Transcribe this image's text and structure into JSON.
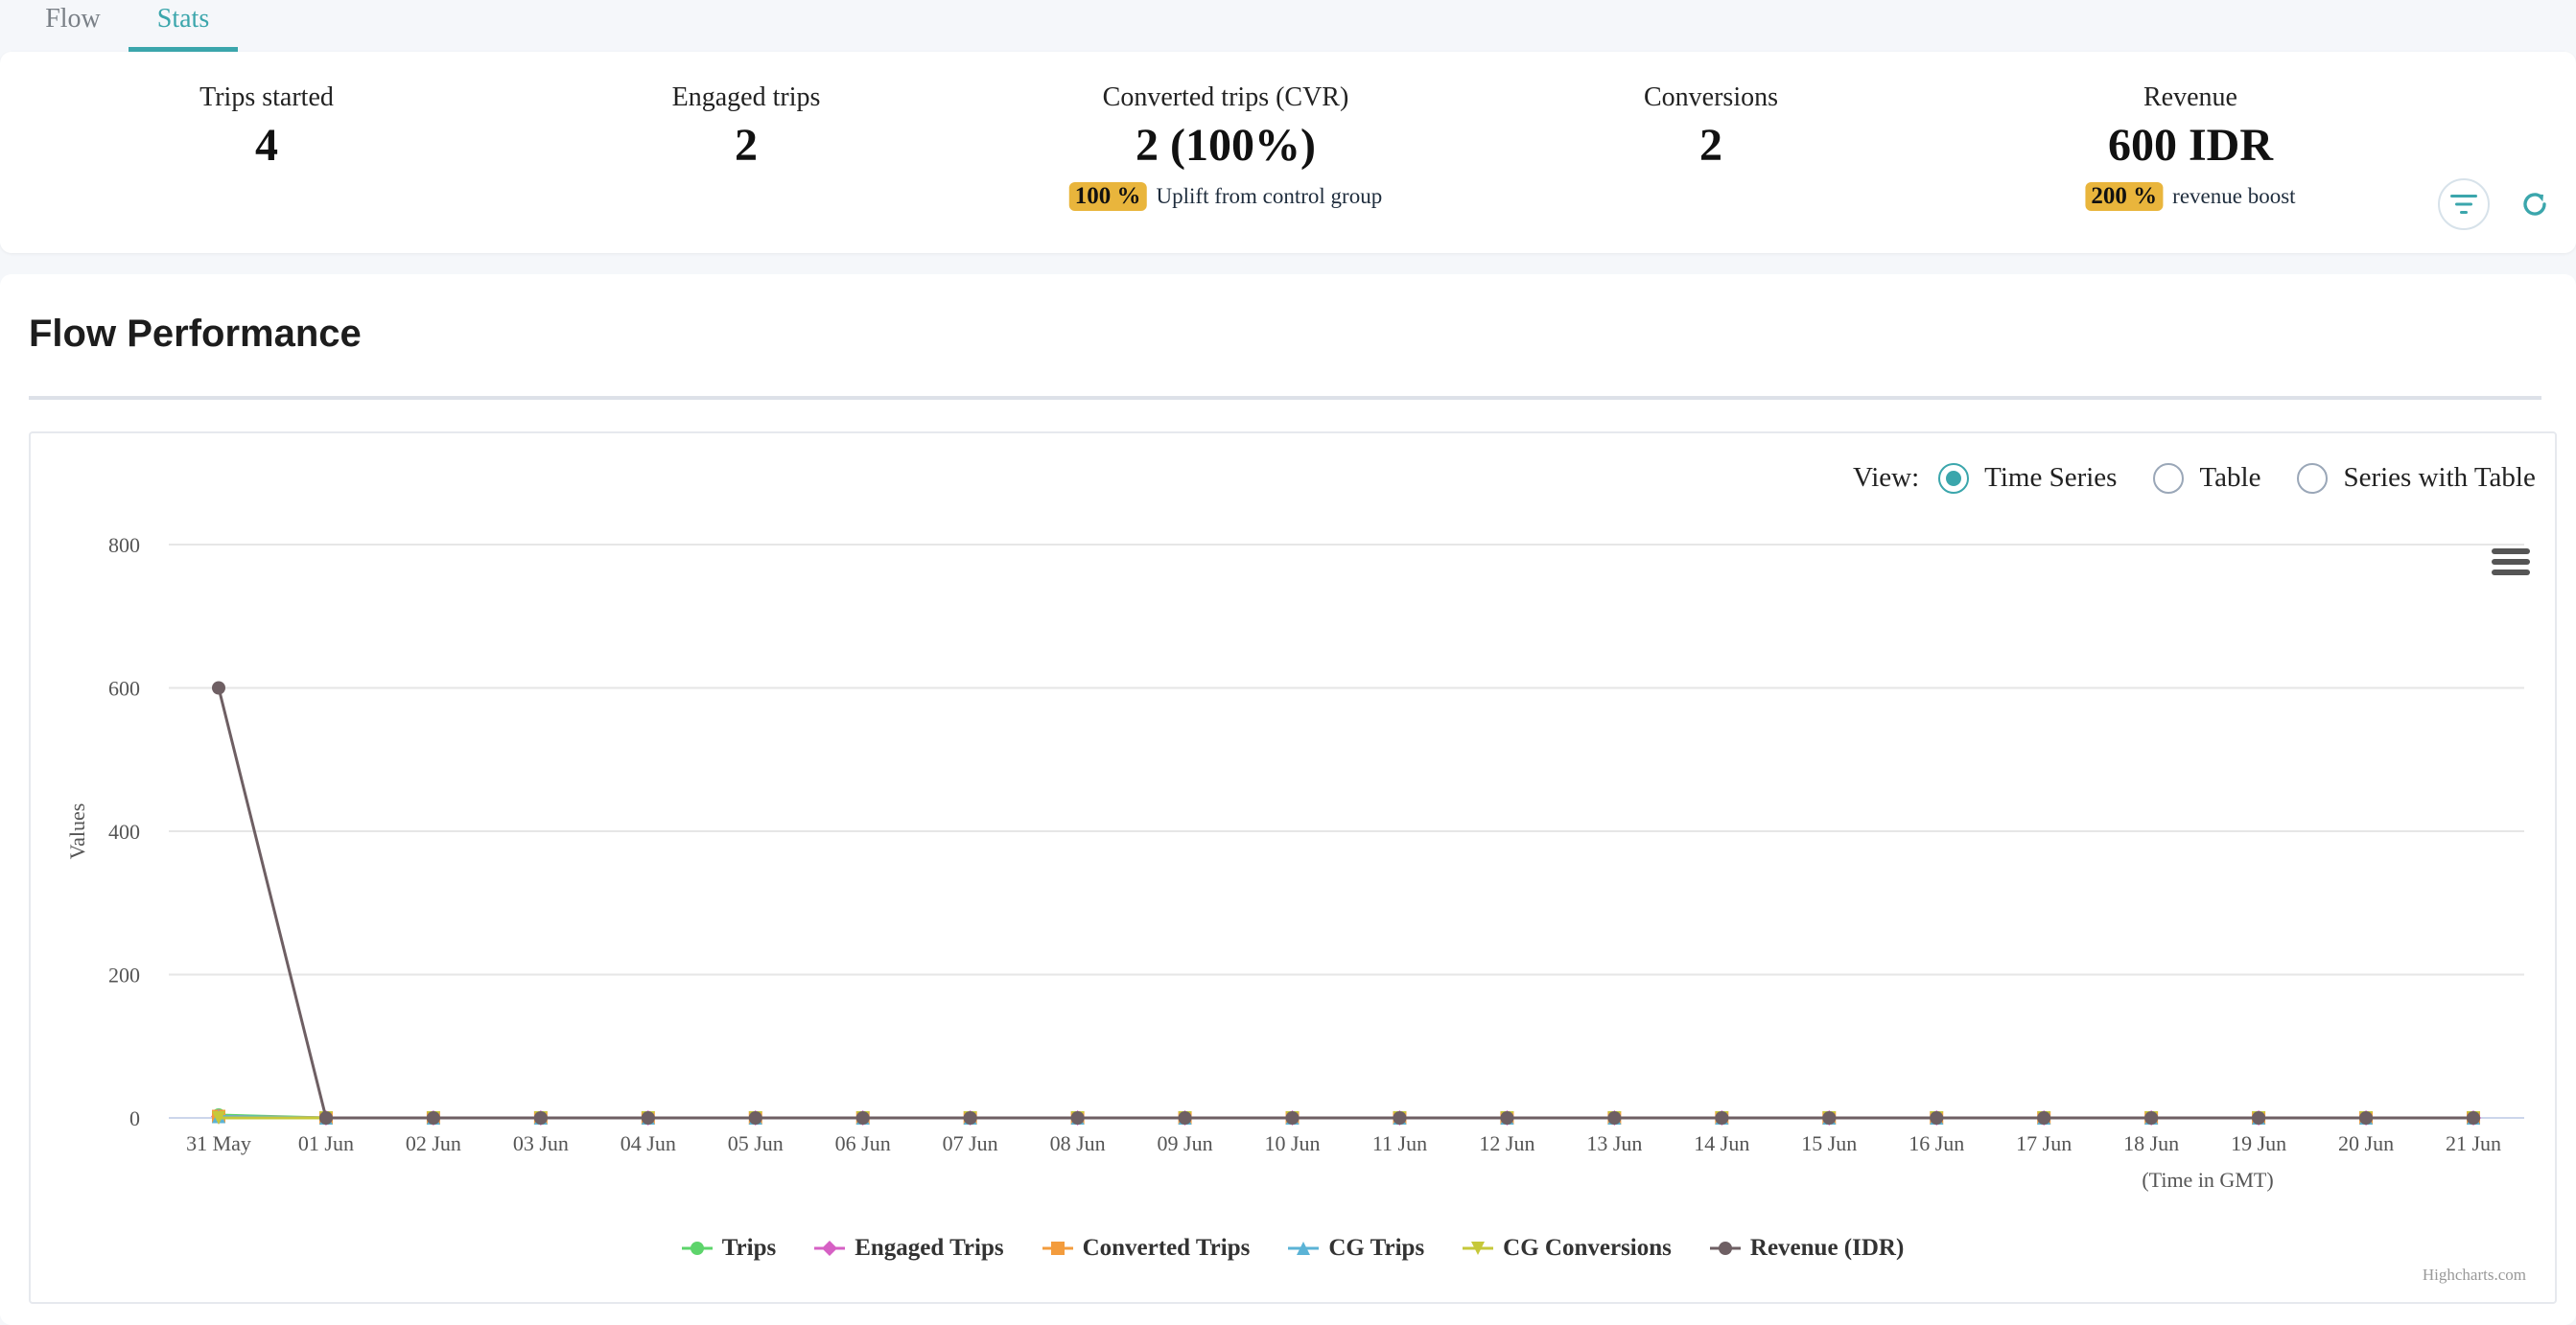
{
  "tabs": [
    {
      "label": "Flow",
      "active": false
    },
    {
      "label": "Stats",
      "active": true
    }
  ],
  "stats": [
    {
      "label": "Trips started",
      "value": "4"
    },
    {
      "label": "Engaged trips",
      "value": "2"
    },
    {
      "label": "Converted trips (CVR)",
      "value": "2 (100%)",
      "badge": "100 %",
      "sub": "Uplift from control group"
    },
    {
      "label": "Conversions",
      "value": "2"
    },
    {
      "label": "Revenue",
      "value": "600 IDR",
      "badge": "200 %",
      "sub": "revenue boost"
    }
  ],
  "toolbar": {
    "filter_icon": "filter-icon",
    "refresh_icon": "refresh-icon",
    "accent": "#3ba6ac"
  },
  "performance": {
    "title": "Flow Performance",
    "view_label": "View:",
    "view_options": [
      {
        "label": "Time Series",
        "selected": true
      },
      {
        "label": "Table",
        "selected": false
      },
      {
        "label": "Series with Table",
        "selected": false
      }
    ],
    "menu_icon": "hamburger-menu-icon",
    "credits": "Highcharts.com"
  },
  "chart_data": {
    "type": "line",
    "ylabel": "Values",
    "xlabel": "(Time in GMT)",
    "ylim": [
      0,
      800
    ],
    "yticks": [
      0,
      200,
      400,
      600,
      800
    ],
    "grid": true,
    "legend_position": "bottom-center",
    "categories": [
      "31 May",
      "01 Jun",
      "02 Jun",
      "03 Jun",
      "04 Jun",
      "05 Jun",
      "06 Jun",
      "07 Jun",
      "08 Jun",
      "09 Jun",
      "10 Jun",
      "11 Jun",
      "12 Jun",
      "13 Jun",
      "14 Jun",
      "15 Jun",
      "16 Jun",
      "17 Jun",
      "18 Jun",
      "19 Jun",
      "20 Jun",
      "21 Jun"
    ],
    "series": [
      {
        "name": "Trips",
        "color": "#5dd46b",
        "marker": "circle",
        "values": [
          4,
          0,
          0,
          0,
          0,
          0,
          0,
          0,
          0,
          0,
          0,
          0,
          0,
          0,
          0,
          0,
          0,
          0,
          0,
          0,
          0,
          0
        ]
      },
      {
        "name": "Engaged Trips",
        "color": "#d660c4",
        "marker": "diamond",
        "values": [
          2,
          0,
          0,
          0,
          0,
          0,
          0,
          0,
          0,
          0,
          0,
          0,
          0,
          0,
          0,
          0,
          0,
          0,
          0,
          0,
          0,
          0
        ]
      },
      {
        "name": "Converted Trips",
        "color": "#f39c3d",
        "marker": "square",
        "values": [
          2,
          0,
          0,
          0,
          0,
          0,
          0,
          0,
          0,
          0,
          0,
          0,
          0,
          0,
          0,
          0,
          0,
          0,
          0,
          0,
          0,
          0
        ]
      },
      {
        "name": "CG Trips",
        "color": "#5bb3d6",
        "marker": "triangle",
        "values": [
          2,
          0,
          0,
          0,
          0,
          0,
          0,
          0,
          0,
          0,
          0,
          0,
          0,
          0,
          0,
          0,
          0,
          0,
          0,
          0,
          0,
          0
        ]
      },
      {
        "name": "CG Conversions",
        "color": "#c6c83a",
        "marker": "triangle-down",
        "values": [
          0,
          0,
          0,
          0,
          0,
          0,
          0,
          0,
          0,
          0,
          0,
          0,
          0,
          0,
          0,
          0,
          0,
          0,
          0,
          0,
          0,
          0
        ]
      },
      {
        "name": "Revenue (IDR)",
        "color": "#6e5f63",
        "marker": "circle",
        "values": [
          600,
          0,
          0,
          0,
          0,
          0,
          0,
          0,
          0,
          0,
          0,
          0,
          0,
          0,
          0,
          0,
          0,
          0,
          0,
          0,
          0,
          0
        ]
      }
    ]
  }
}
